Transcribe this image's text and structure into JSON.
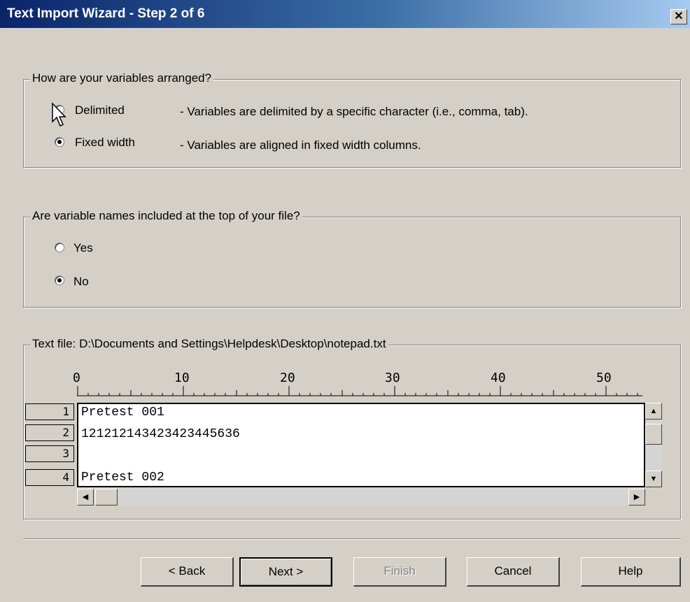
{
  "window": {
    "title": "Text Import Wizard - Step 2 of 6",
    "close_glyph": "✕"
  },
  "arrangement": {
    "title": "How are your variables arranged?",
    "options": [
      {
        "label": "Delimited",
        "description": "- Variables are delimited by a specific character (i.e., comma, tab).",
        "selected": false
      },
      {
        "label": "Fixed width",
        "description": "- Variables are aligned in fixed width columns.",
        "selected": true
      }
    ]
  },
  "names": {
    "title": "Are variable names included at the top of your file?",
    "options": [
      {
        "label": "Yes",
        "selected": false
      },
      {
        "label": "No",
        "selected": true
      }
    ]
  },
  "preview": {
    "title": "Text file: D:\\Documents and Settings\\Helpdesk\\Desktop\\notepad.txt",
    "ruler": [
      "0",
      "10",
      "20",
      "30",
      "40",
      "50"
    ],
    "rows": [
      {
        "num": "1",
        "text": "Pretest 001"
      },
      {
        "num": "2",
        "text": "121212143423423445636"
      },
      {
        "num": "3",
        "text": ""
      },
      {
        "num": "4",
        "text": "Pretest 002"
      }
    ]
  },
  "buttons": {
    "back": "< Back",
    "next": "Next >",
    "finish": "Finish",
    "cancel": "Cancel",
    "help": "Help"
  },
  "icons": {
    "close": "close-icon",
    "cursor": "mouse-pointer-icon"
  }
}
